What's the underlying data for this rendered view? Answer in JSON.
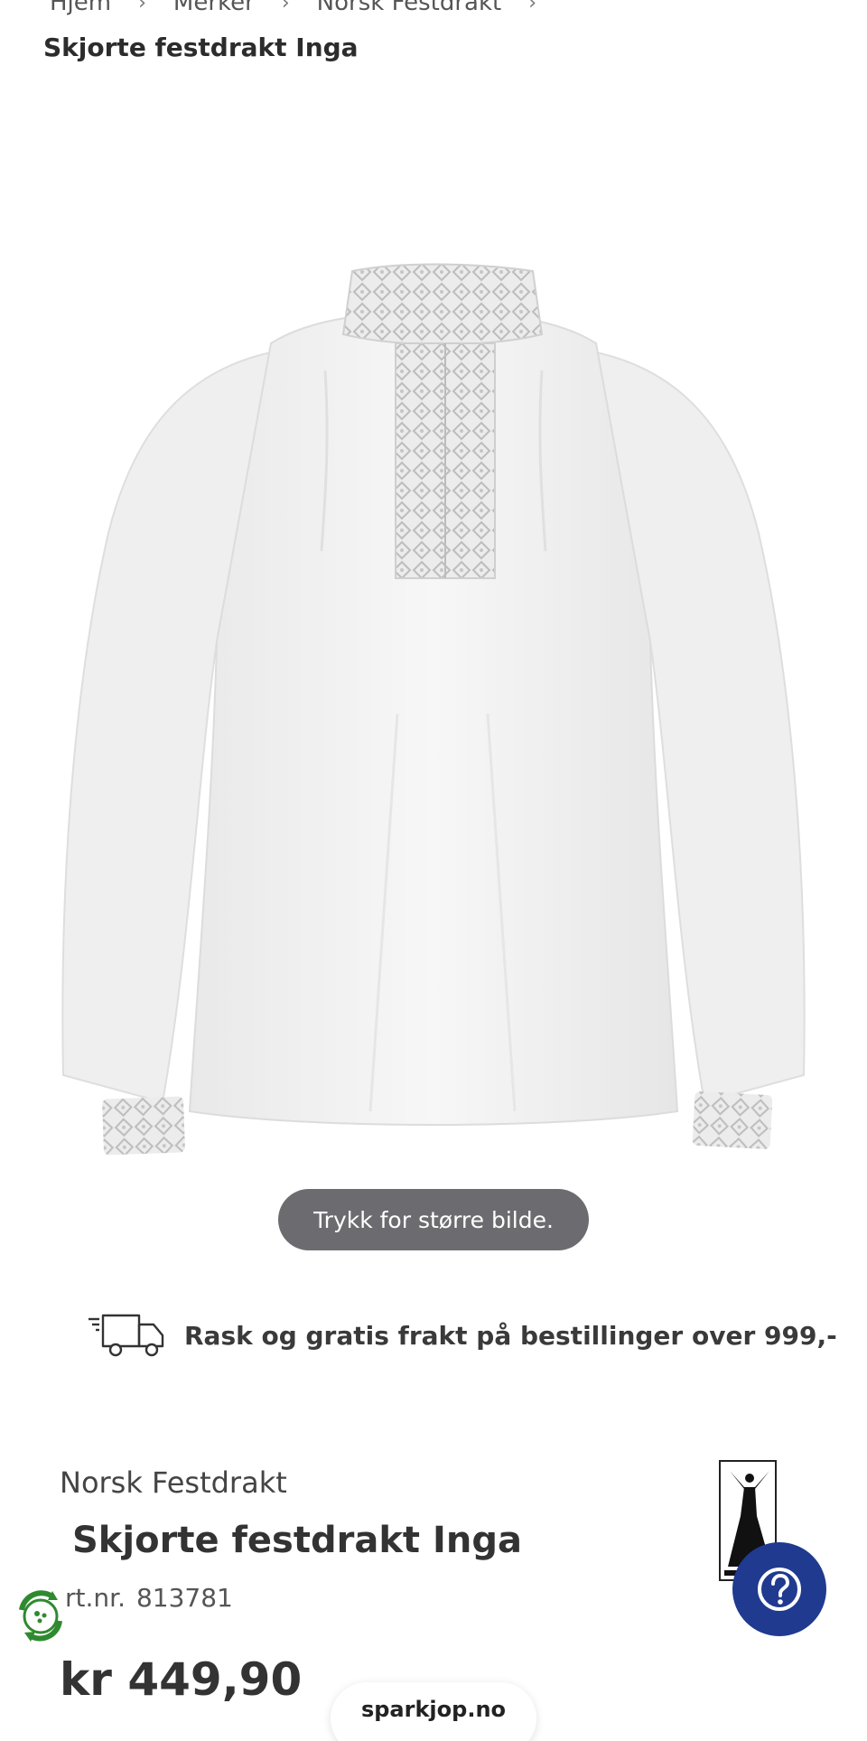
{
  "breadcrumb": {
    "items": [
      "Hjem",
      "Merker",
      "Norsk Festdrakt"
    ],
    "current": "Skjorte festdrakt Inga"
  },
  "image": {
    "icon": "shirt-product-image",
    "zoom_hint": "Trykk for større bilde."
  },
  "shipping": {
    "icon": "delivery-truck-icon",
    "text": "Rask og gratis frakt på bestillinger over 999,-"
  },
  "product": {
    "brand": "Norsk Festdrakt",
    "title": "Skjorte festdrakt Inga",
    "artnr_label": "rt.nr.",
    "artnr_value": "813781",
    "price": "kr 449,90"
  },
  "help": {
    "icon": "question-mark-icon"
  },
  "eco_badge": {
    "icon": "recycle-badge-icon"
  },
  "site_badge": {
    "label": "sparkjop.no"
  },
  "colors": {
    "help_blue": "#1f3a8f",
    "pill_gray": "#6c6c70",
    "eco_green": "#2f8a2f"
  }
}
